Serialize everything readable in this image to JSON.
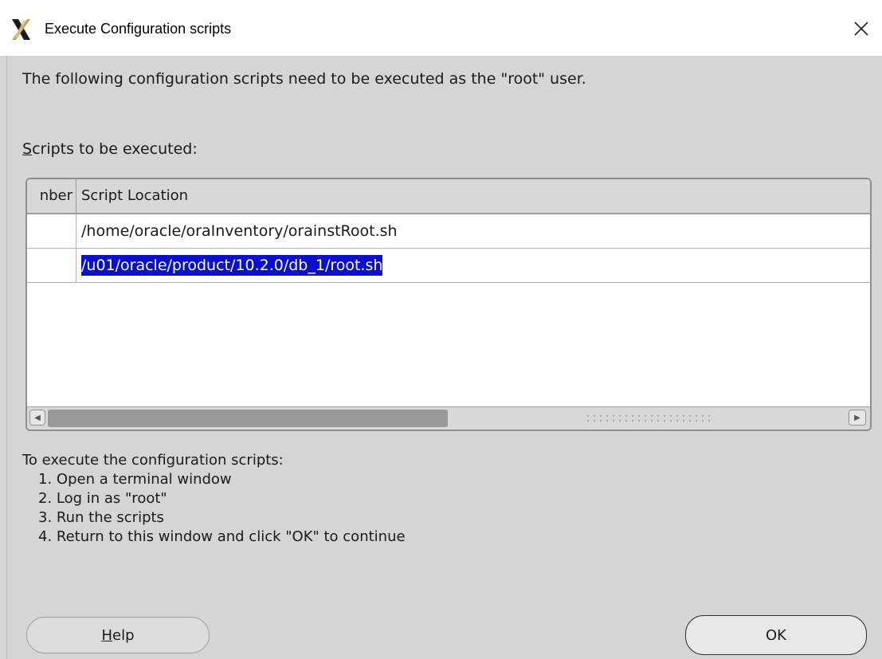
{
  "window": {
    "title": "Execute Configuration scripts",
    "close_symbol": "×"
  },
  "intro": "The following configuration scripts need to be executed as the \"root\" user.",
  "scripts_label_mnemonic": "S",
  "scripts_label_rest": "cripts to be executed:",
  "table": {
    "columns": [
      "nber",
      "Script Location"
    ],
    "rows": [
      {
        "number": "",
        "location": "/home/oracle/oraInventory/orainstRoot.sh",
        "selected": false
      },
      {
        "number": "",
        "location": "/u01/oracle/product/10.2.0/db_1/root.sh",
        "selected": true
      }
    ]
  },
  "scrollbar": {
    "left_arrow": "◀",
    "right_arrow": "▶"
  },
  "instructions": {
    "heading": "To execute the configuration scripts:",
    "steps": [
      "1. Open a terminal window",
      "2. Log in as \"root\"",
      "3. Run the scripts",
      "4. Return to this window and click \"OK\" to continue"
    ]
  },
  "buttons": {
    "help_mnemonic": "H",
    "help_rest": "elp",
    "ok": "OK"
  },
  "icons": {
    "app_icon": "x-logo-icon",
    "close": "close-icon"
  }
}
